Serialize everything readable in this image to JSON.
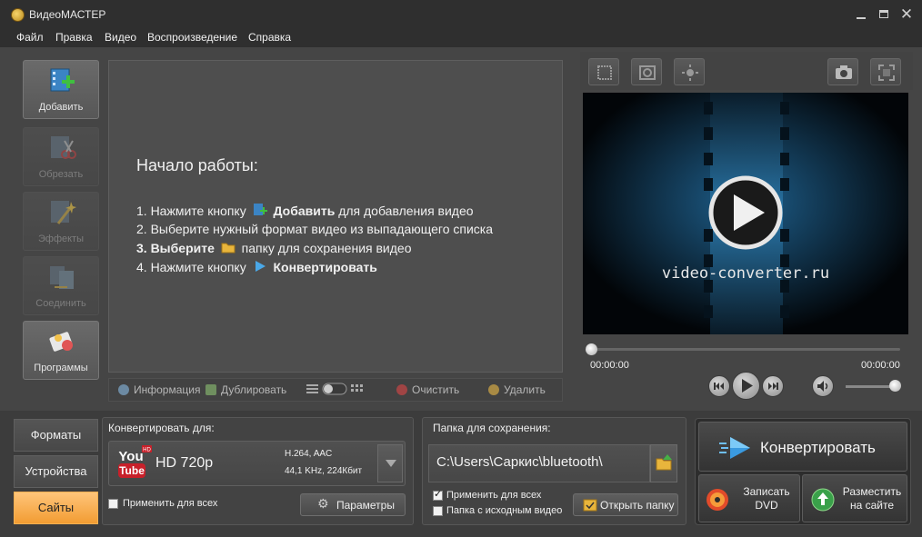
{
  "window": {
    "title": "ВидеоМАСТЕР"
  },
  "menu": {
    "file": "Файл",
    "edit": "Правка",
    "video": "Видео",
    "playback": "Воспроизведение",
    "help": "Справка"
  },
  "tools": {
    "add": "Добавить",
    "cut": "Обрезать",
    "effects": "Эффекты",
    "join": "Соединить",
    "programs": "Программы"
  },
  "intro": {
    "title": "Начало работы:",
    "step1_pre": "1. Нажмите кнопку",
    "step1_bold": "Добавить",
    "step1_post": "для добавления видео",
    "step2": "2. Выберите нужный формат видео из выпадающего списка",
    "step3_bold": "3. Выберите",
    "step3_post": "папку для сохранения видео",
    "step4_pre": "4. Нажмите кнопку",
    "step4_bold": "Конвертировать"
  },
  "list_toolbar": {
    "info": "Информация",
    "duplicate": "Дублировать",
    "clear": "Очистить",
    "delete": "Удалить"
  },
  "preview": {
    "watermark": "video-converter.ru",
    "time_current": "00:00:00",
    "time_total": "00:00:00",
    "seek_progress": 0,
    "volume_level": 0.9
  },
  "categories": {
    "formats": "Форматы",
    "devices": "Устройства",
    "sites": "Сайты"
  },
  "convert_for": {
    "label": "Конвертировать для:",
    "logo_top": "You",
    "logo_bottom": "Tube",
    "logo_badge": "HD",
    "format": "HD 720p",
    "codec": "H.264, AAC",
    "audio": "44,1 KHz, 224Кбит",
    "apply_all": "Применить для всех",
    "params": "Параметры"
  },
  "save_folder": {
    "label": "Папка для сохранения:",
    "path": "C:\\Users\\Саркис\\bluetooth\\",
    "apply_all": "Применить для всех",
    "source_folder": "Папка с исходным видео",
    "open_folder": "Открыть папку"
  },
  "actions": {
    "convert": "Конвертировать",
    "dvd_line1": "Записать",
    "dvd_line2": "DVD",
    "publish_line1": "Разместить",
    "publish_line2": "на сайте"
  },
  "colors": {
    "accent": "#f29c32",
    "video_blue": "#1e5f8c"
  }
}
